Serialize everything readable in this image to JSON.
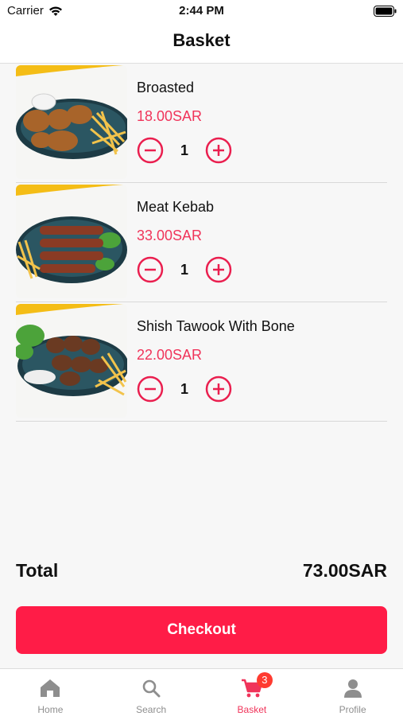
{
  "status_bar": {
    "carrier": "Carrier",
    "time": "2:44 PM"
  },
  "header": {
    "title": "Basket"
  },
  "items": [
    {
      "name": "Broasted",
      "price": "18.00SAR",
      "quantity": "1",
      "image": "broasted-plate"
    },
    {
      "name": "Meat Kebab",
      "price": "33.00SAR",
      "quantity": "1",
      "image": "kebab-plate"
    },
    {
      "name": "Shish Tawook With Bone",
      "price": "22.00SAR",
      "quantity": "1",
      "image": "tawook-plate"
    }
  ],
  "total": {
    "label": "Total",
    "value": "73.00SAR"
  },
  "checkout": {
    "label": "Checkout"
  },
  "tabs": [
    {
      "label": "Home",
      "icon": "home-icon"
    },
    {
      "label": "Search",
      "icon": "search-icon"
    },
    {
      "label": "Basket",
      "icon": "cart-icon",
      "badge": "3",
      "active": true
    },
    {
      "label": "Profile",
      "icon": "user-icon"
    }
  ],
  "colors": {
    "accent": "#ff1c47",
    "price": "#f0345a",
    "inactive_tab": "#8e8e8e"
  }
}
